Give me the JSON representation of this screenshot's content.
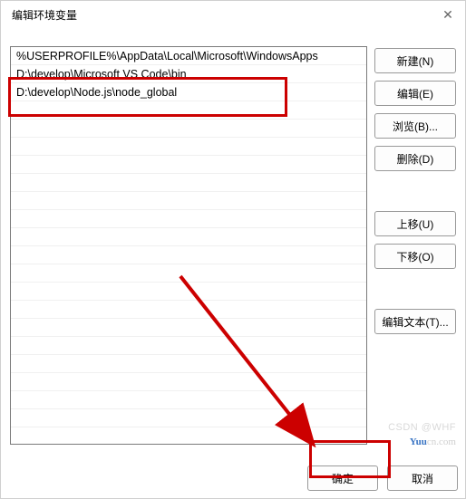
{
  "titlebar": {
    "title": "编辑环境变量"
  },
  "list": {
    "rows": [
      "%USERPROFILE%\\AppData\\Local\\Microsoft\\WindowsApps",
      "D:\\develop\\Microsoft VS Code\\bin",
      "D:\\develop\\Node.js\\node_global"
    ]
  },
  "buttons": {
    "new": "新建(N)",
    "edit": "编辑(E)",
    "browse": "浏览(B)...",
    "delete": "删除(D)",
    "move_up": "上移(U)",
    "move_down": "下移(O)",
    "edit_text": "编辑文本(T)...",
    "ok": "确定",
    "cancel": "取消"
  },
  "watermark": {
    "csdn": "CSDN @WHF",
    "site": "Yuucn.com",
    "site_pre": "Yuu",
    "site_suf": "cn.com"
  }
}
